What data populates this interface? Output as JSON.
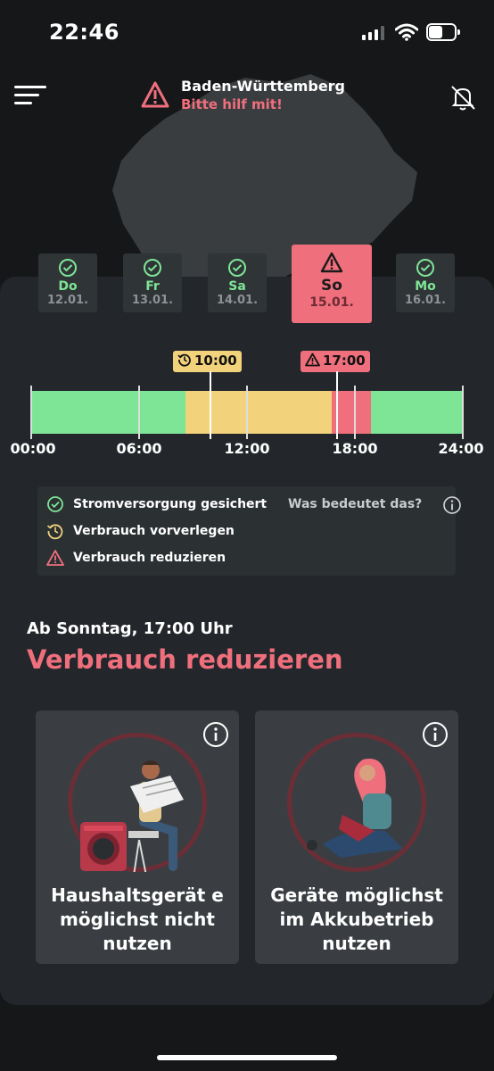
{
  "status": {
    "time": "22:46",
    "battery_level": 0.55
  },
  "header": {
    "region": "Baden-Württemberg",
    "subtitle": "Bitte hilf mit!"
  },
  "days": [
    {
      "name": "Do",
      "date": "12.01.",
      "status": "ok"
    },
    {
      "name": "Fr",
      "date": "13.01.",
      "status": "ok"
    },
    {
      "name": "Sa",
      "date": "14.01.",
      "status": "ok"
    },
    {
      "name": "So",
      "date": "15.01.",
      "status": "warning",
      "selected": true
    },
    {
      "name": "Mo",
      "date": "16.01.",
      "status": "ok"
    }
  ],
  "timeline": {
    "markers": {
      "shift_start": "10:00",
      "reduce_start": "17:00"
    },
    "ticks": [
      "00:00",
      "06:00",
      "12:00",
      "18:00",
      "24:00"
    ],
    "segments": [
      {
        "from": 0,
        "to": 8.6,
        "state": "green"
      },
      {
        "from": 8.6,
        "to": 16.7,
        "state": "yellow"
      },
      {
        "from": 16.7,
        "to": 18.9,
        "state": "red"
      },
      {
        "from": 18.9,
        "to": 24,
        "state": "green"
      }
    ]
  },
  "legend": {
    "items": [
      "Stromversorgung gesichert",
      "Verbrauch vorverlegen",
      "Verbrauch reduzieren"
    ],
    "help": "Was bedeutet das?"
  },
  "action": {
    "when": "Ab Sonntag, 17:00 Uhr",
    "title": "Verbrauch reduzieren",
    "cards": [
      "Haushaltsgerät e möglichst nicht nutzen",
      "Geräte möglichst im Akkubetrieb nutzen"
    ]
  },
  "colors": {
    "green": "#7ee596",
    "yellow": "#f2d27a",
    "red": "#ef6f7d",
    "panel": "#23272b"
  }
}
